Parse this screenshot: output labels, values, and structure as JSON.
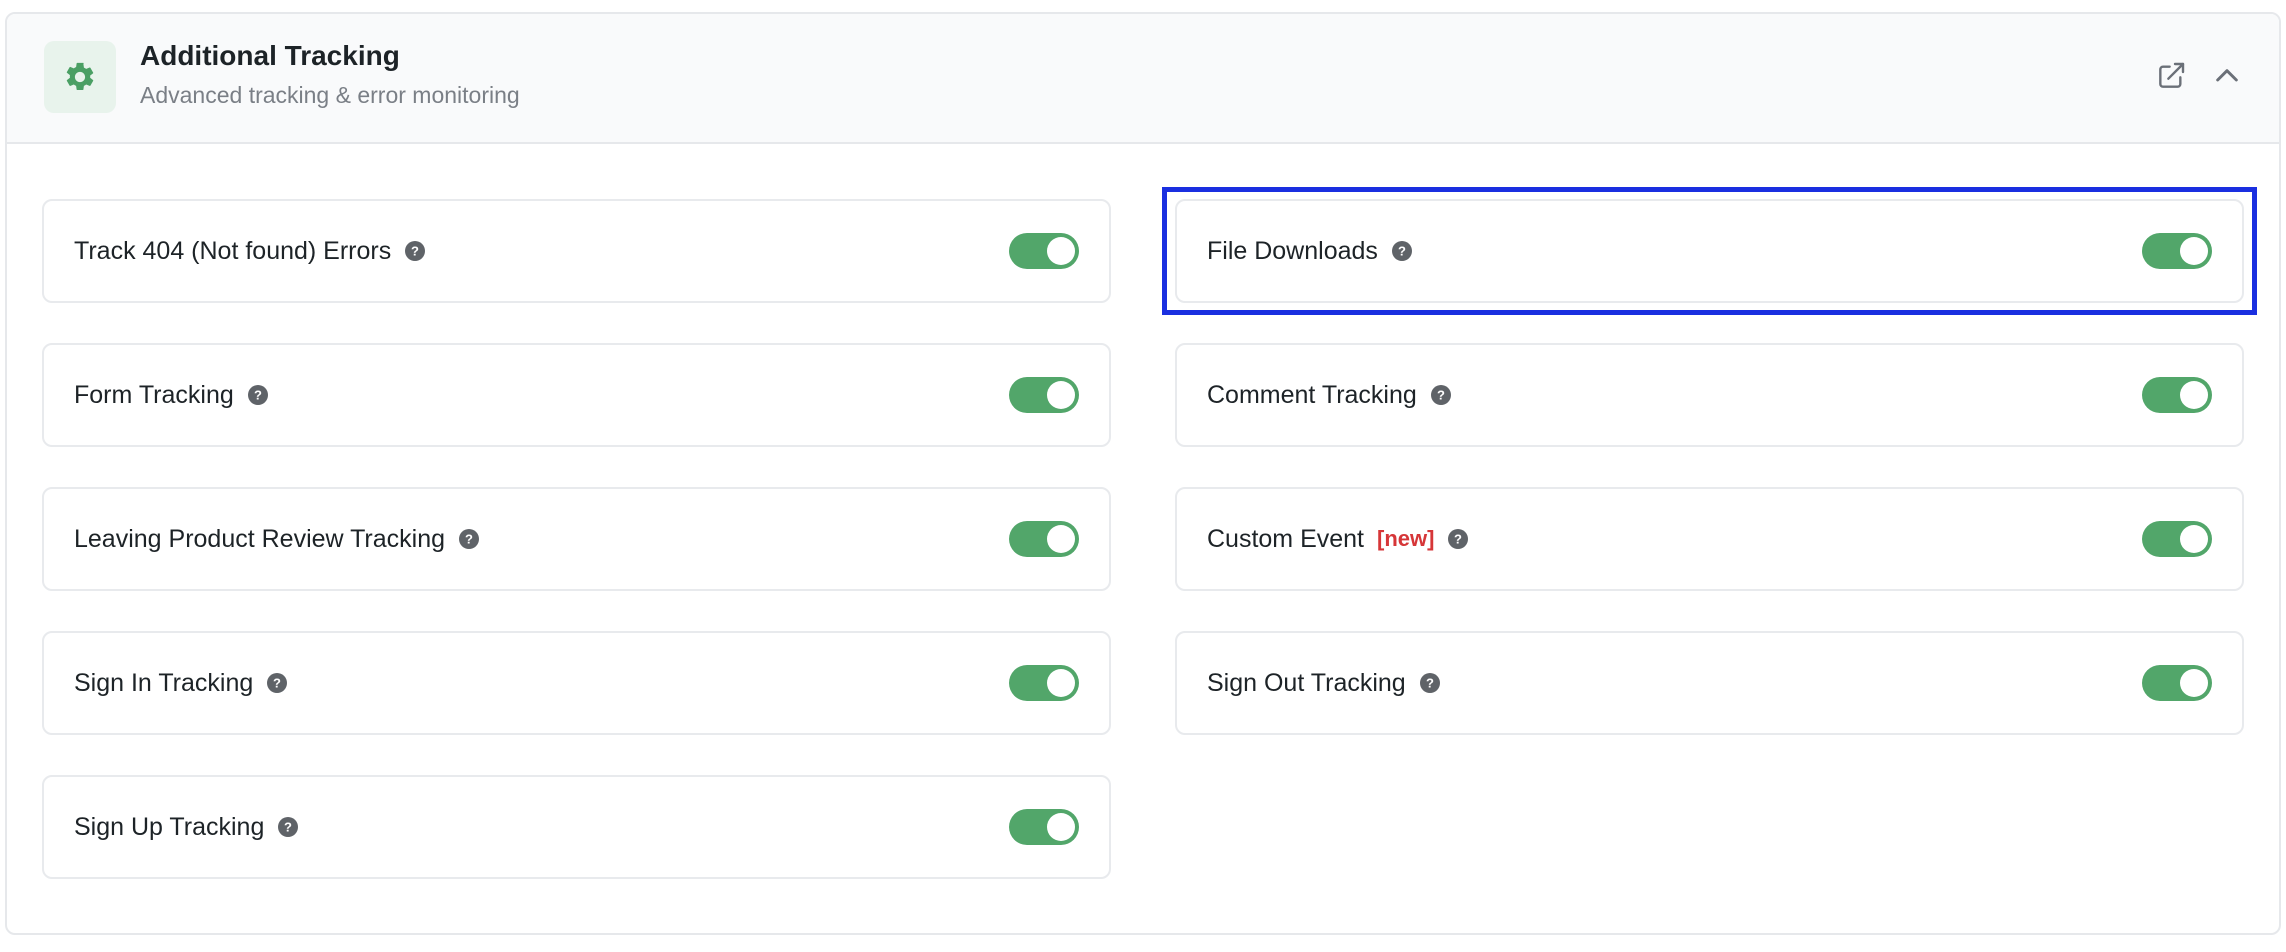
{
  "header": {
    "title": "Additional Tracking",
    "subtitle": "Advanced tracking & error monitoring",
    "icon": "gear-icon",
    "actions": [
      {
        "name": "external-link-icon"
      },
      {
        "name": "chevron-up-icon"
      }
    ]
  },
  "colors": {
    "accent": "#52a66a",
    "badge": "#d63638",
    "highlight": "#1a2fe0"
  },
  "options": [
    {
      "label": "Track 404 (Not found) Errors",
      "enabled": true
    },
    {
      "label": "File Downloads",
      "enabled": true
    },
    {
      "label": "Form Tracking",
      "enabled": true
    },
    {
      "label": "Comment Tracking",
      "enabled": true
    },
    {
      "label": "Leaving Product Review Tracking",
      "enabled": true
    },
    {
      "label": "Custom Event",
      "badge": "[new]",
      "enabled": true
    },
    {
      "label": "Sign In Tracking",
      "enabled": true
    },
    {
      "label": "Sign Out Tracking",
      "enabled": true
    },
    {
      "label": "Sign Up Tracking",
      "enabled": true
    }
  ]
}
